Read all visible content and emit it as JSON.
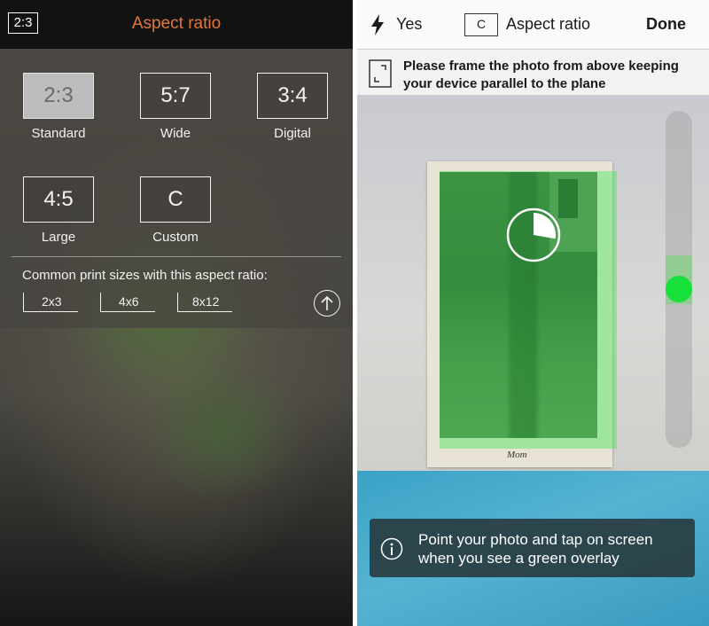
{
  "left": {
    "ratio_badge": "2:3",
    "title": "Aspect ratio",
    "options": [
      {
        "value": "2:3",
        "label": "Standard",
        "selected": true
      },
      {
        "value": "5:7",
        "label": "Wide",
        "selected": false
      },
      {
        "value": "3:4",
        "label": "Digital",
        "selected": false
      },
      {
        "value": "4:5",
        "label": "Large",
        "selected": false
      },
      {
        "value": "C",
        "label": "Custom",
        "selected": false
      }
    ],
    "common_sizes_label": "Common print sizes with this aspect ratio:",
    "print_sizes": [
      "2x3",
      "4x6",
      "8x12"
    ],
    "icons": {
      "up": "arrow-up-circle-icon"
    },
    "colors": {
      "title": "#e2773d"
    }
  },
  "right": {
    "flash_label": "Yes",
    "aspect_badge": "C",
    "aspect_label": "Aspect ratio",
    "done_label": "Done",
    "instruction": "Please frame the photo from above keeping your device parallel to the plane",
    "photo_caption": "Mom",
    "toast_text": "Point your photo and tap on screen when you see a green overlay",
    "level_slider": 0.53,
    "icons": {
      "flash": "flash-icon",
      "frame": "frame-icon",
      "info": "info-icon",
      "pie": "pie-progress-icon"
    },
    "colors": {
      "overlay": "#3ce650",
      "level_knob": "#18e03a",
      "toast_bg": "#283a3e"
    }
  }
}
